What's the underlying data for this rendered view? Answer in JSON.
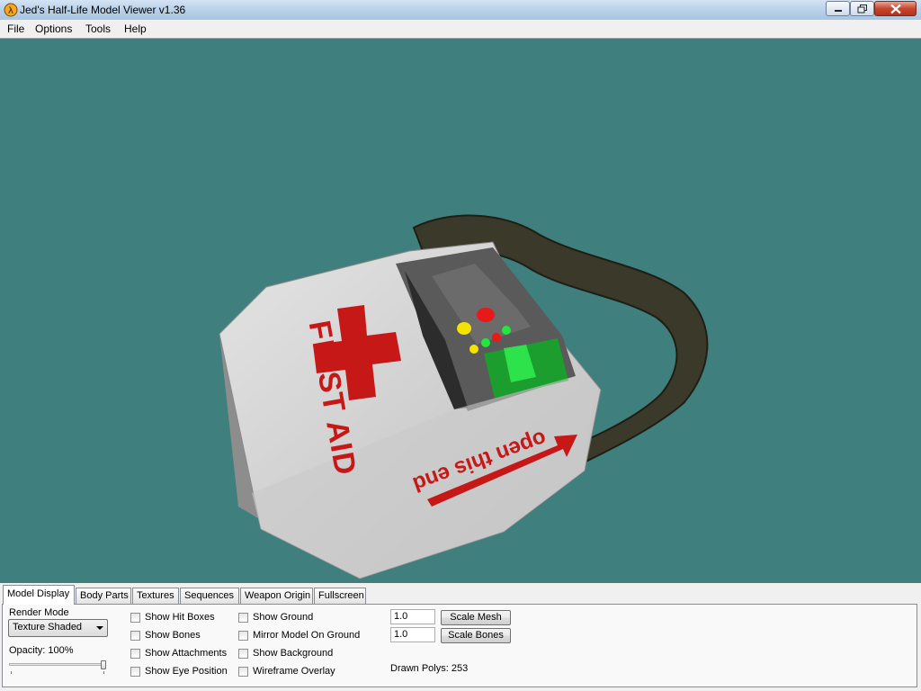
{
  "window": {
    "title": "Jed's Half-Life Model Viewer v1.36",
    "app_icon": "hl-logo-icon",
    "controls": [
      "minimize-icon",
      "maximize-icon",
      "close-icon"
    ]
  },
  "menu": {
    "items": [
      "File",
      "Options",
      "Tools",
      "Help"
    ]
  },
  "viewport": {
    "background": "#3f7f7d",
    "model": {
      "label_front": "FIRST AID",
      "label_side": "open this end",
      "accent": "#cc1d1d"
    }
  },
  "panel": {
    "tabs": [
      "Model Display",
      "Body Parts",
      "Textures",
      "Sequences",
      "Weapon Origin",
      "Fullscreen"
    ],
    "active_tab": "Model Display",
    "render_mode": {
      "label": "Render Mode",
      "value": "Texture Shaded"
    },
    "opacity": {
      "label": "Opacity: 100%",
      "value": 1.0
    },
    "checkboxes_col1": [
      "Show Hit Boxes",
      "Show Bones",
      "Show Attachments",
      "Show Eye Position"
    ],
    "checkboxes_col2": [
      "Show Ground",
      "Mirror Model On Ground",
      "Show Background",
      "Wireframe Overlay"
    ],
    "scale_mesh": {
      "value": "1.0",
      "button": "Scale Mesh"
    },
    "scale_bones": {
      "value": "1.0",
      "button": "Scale Bones"
    },
    "drawn_polys": "Drawn Polys: 253"
  }
}
